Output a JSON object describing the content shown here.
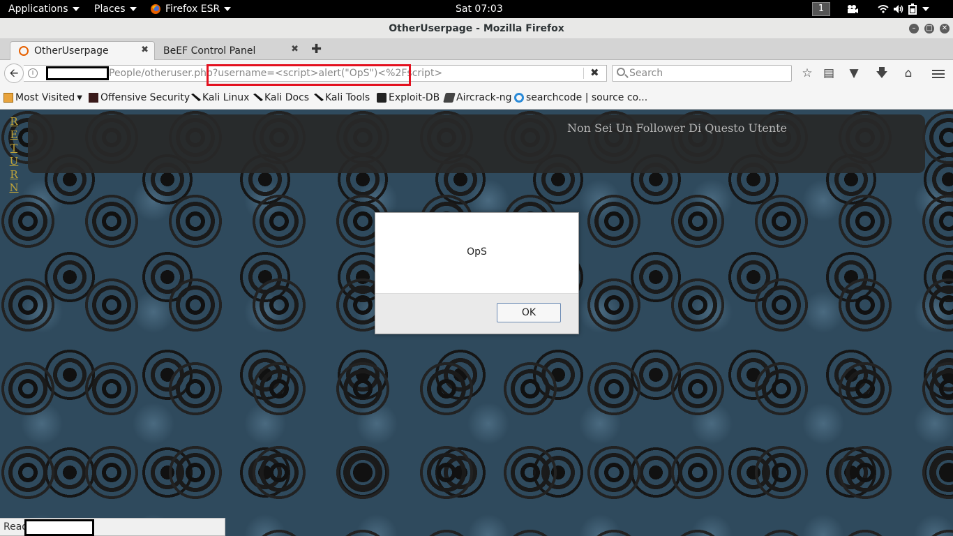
{
  "system_bar": {
    "applications": "Applications",
    "places": "Places",
    "app_name": "Firefox ESR",
    "clock": "Sat 07:03",
    "workspace": "1"
  },
  "window": {
    "title": "OtherUserpage - Mozilla Firefox"
  },
  "tabs": [
    {
      "label": "OtherUserpage",
      "active": true
    },
    {
      "label": "BeEF Control Panel",
      "active": false
    }
  ],
  "address_bar": {
    "url_path": "People/otheruser.php?username=<script>alert(\"OpS\")<%2Fscript>",
    "search_placeholder": "Search"
  },
  "bookmarks": [
    {
      "label": "Most Visited",
      "icon": "folder-icon"
    },
    {
      "label": "Offensive Security",
      "icon": "offsec-icon"
    },
    {
      "label": "Kali Linux",
      "icon": "kali-dragon-icon"
    },
    {
      "label": "Kali Docs",
      "icon": "kali-dragon-icon"
    },
    {
      "label": "Kali Tools",
      "icon": "kali-dragon-icon"
    },
    {
      "label": "Exploit-DB",
      "icon": "exploitdb-icon"
    },
    {
      "label": "Aircrack-ng",
      "icon": "aircrack-icon"
    },
    {
      "label": "searchcode | source co...",
      "icon": "searchcode-icon"
    }
  ],
  "page": {
    "return_link": "RETURN",
    "header_message": "Non Sei Un Follower Di Questo Utente"
  },
  "dialog": {
    "message": "OpS",
    "ok_label": "OK"
  },
  "status_bar": {
    "text": "Read"
  },
  "colors": {
    "highlight": "#e3101e",
    "return_link": "#bfa43a",
    "page_background": "#2f4a5d"
  }
}
